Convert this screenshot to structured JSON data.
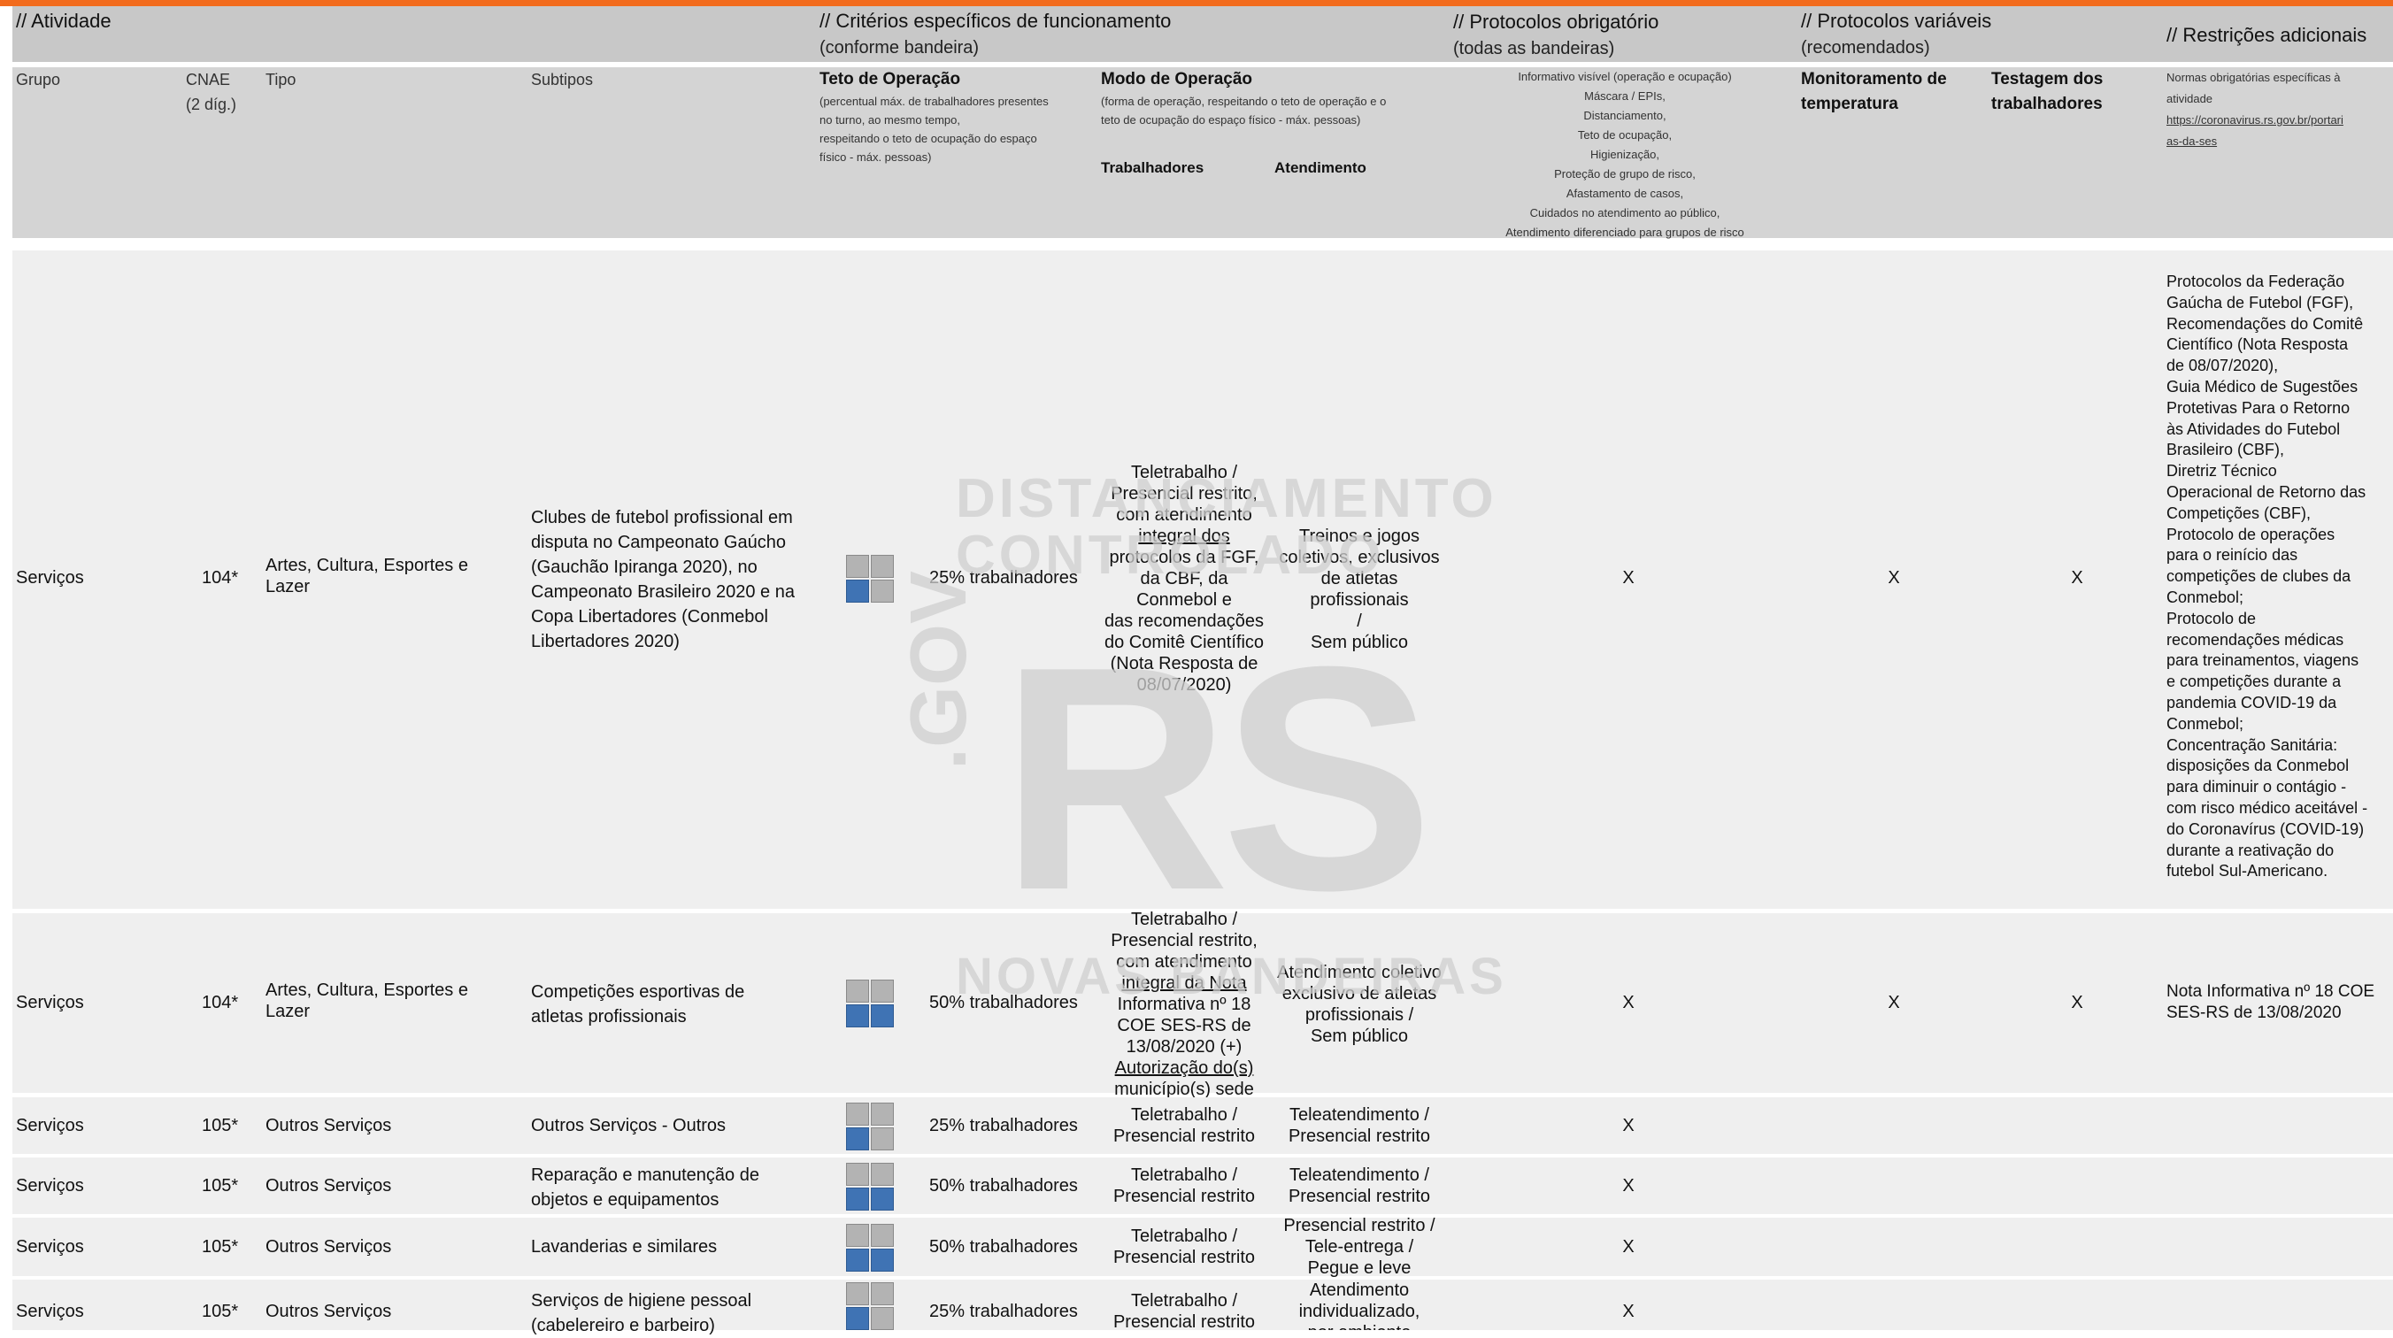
{
  "sections": {
    "atividade": "// Atividade",
    "criterios": "// Critérios específicos de funcionamento",
    "criterios_sub": "(conforme bandeira)",
    "protocolos_obrig": "// Protocolos obrigatório",
    "protocolos_obrig_sub": "(todas as bandeiras)",
    "protocolos_var": "// Protocolos variáveis",
    "protocolos_var_sub": "(recomendados)",
    "restricoes": "// Restrições adicionais"
  },
  "columns": {
    "grupo": "Grupo",
    "cnae_1": "CNAE",
    "cnae_2": "(2 díg.)",
    "tipo": "Tipo",
    "subtipos": "Subtipos",
    "teto": "Teto de Operação",
    "teto_desc": [
      "(percentual máx. de trabalhadores presentes",
      "no turno, ao mesmo tempo,",
      "respeitando o teto de ocupação do espaço",
      "físico - máx. pessoas)"
    ],
    "modo": "Modo de Operação",
    "modo_desc": [
      "(forma de operação, respeitando o teto de operação e o",
      "teto de ocupação do espaço físico - máx. pessoas)"
    ],
    "trabalhadores": "Trabalhadores",
    "atendimento": "Atendimento",
    "protocolos_list": [
      "Informativo visível (operação e ocupação)",
      "Máscara / EPIs,",
      "Distanciamento,",
      "Teto de ocupação,",
      "Higienização,",
      "Proteção de grupo de risco,",
      "Afastamento de casos,",
      "Cuidados no atendimento ao público,",
      "Atendimento diferenciado para grupos de risco"
    ],
    "monitoramento_1": "Monitoramento de",
    "monitoramento_2": "temperatura",
    "testagem_1": "Testagem dos",
    "testagem_2": "trabalhadores",
    "normas_1": "Normas obrigatórias específicas à",
    "normas_2": "atividade",
    "normas_link_1": "https://coronavirus.rs.gov.br/portari",
    "normas_link_2": "as-da-ses"
  },
  "watermark": {
    "line1": "DISTANCIAMENTO",
    "line2": "CONTROLADO",
    "line3": "NOVAS BANDEIRAS",
    "gov": ".GOV",
    "rs": "RS"
  },
  "rows": [
    {
      "grupo": "Serviços",
      "cnae": "104*",
      "tipo": [
        "Artes, Cultura, Esportes e",
        "Lazer"
      ],
      "subtipo": [
        "Clubes de futebol profissional em",
        "disputa no Campeonato Gaúcho",
        "(Gauchão Ipiranga 2020), no",
        "Campeonato Brasileiro 2020 e na",
        "Copa Libertadores (Conmebol",
        "Libertadores 2020)"
      ],
      "teto": "25% trabalhadores",
      "trabalhadores": [
        "Teletrabalho /",
        "Presencial restrito,",
        "com atendimento",
        "integral dos",
        "protocolos da FGF,",
        "da CBF, da",
        "Conmebol e",
        "das recomendações",
        "do Comitê Científico",
        "(Nota Resposta de",
        "08/07/2020)"
      ],
      "atendimento": [
        "Treinos e jogos",
        "coletivos, exclusivos",
        "de atletas profissionais",
        "/",
        "Sem público"
      ],
      "obrig": "X",
      "monit": "X",
      "testagem": "X",
      "restricoes": [
        "Protocolos da Federação",
        "Gaúcha de Futebol (FGF),",
        "Recomendações do Comitê",
        "Científico (Nota Resposta",
        "de 08/07/2020),",
        "Guia Médico de Sugestões",
        "Protetivas Para o Retorno",
        "às Atividades do Futebol",
        "Brasileiro (CBF),",
        "Diretriz Técnico",
        "Operacional de Retorno das",
        "Competições (CBF),",
        "Protocolo de operações",
        "para o reinício das",
        "competições de clubes da",
        "Conmebol;",
        "Protocolo de",
        "recomendações médicas",
        "para treinamentos, viagens",
        "e competições durante a",
        "pandemia COVID-19 da",
        "Conmebol;",
        "Concentração Sanitária:",
        "disposições da Conmebol",
        "para diminuir o contágio -",
        "com risco médico aceitável -",
        "do Coronavírus (COVID-19)",
        "durante a reativação do",
        "futebol Sul-Americano."
      ]
    },
    {
      "grupo": "Serviços",
      "cnae": "104*",
      "tipo": [
        "Artes, Cultura, Esportes e",
        "Lazer"
      ],
      "subtipo": [
        "Competições esportivas de",
        "atletas profissionais"
      ],
      "teto": "50% trabalhadores",
      "trabalhadores": [
        "Teletrabalho /",
        "Presencial restrito,",
        "com atendimento",
        "integral da Nota",
        "Informativa nº 18",
        "COE SES-RS de",
        "13/08/2020 (+)",
        "Autorização do(s)",
        "município(s) sede"
      ],
      "atendimento": [
        "Atendimento coletivo",
        "exclusivo de atletas",
        "profissionais /",
        "Sem público"
      ],
      "obrig": "X",
      "monit": "X",
      "testagem": "X",
      "restricoes": [
        "Nota Informativa nº 18 COE",
        "SES-RS de 13/08/2020"
      ]
    },
    {
      "grupo": "Serviços",
      "cnae": "105*",
      "tipo": [
        "Outros Serviços"
      ],
      "subtipo": [
        "Outros Serviços - Outros"
      ],
      "teto": "25% trabalhadores",
      "trabalhadores": [
        "Teletrabalho /",
        "Presencial restrito"
      ],
      "atendimento": [
        "Teleatendimento /",
        "Presencial restrito"
      ],
      "obrig": "X"
    },
    {
      "grupo": "Serviços",
      "cnae": "105*",
      "tipo": [
        "Outros Serviços"
      ],
      "subtipo": [
        "Reparação e manutenção de",
        "objetos e equipamentos"
      ],
      "teto": "50% trabalhadores",
      "trabalhadores": [
        "Teletrabalho /",
        "Presencial restrito"
      ],
      "atendimento": [
        "Teleatendimento /",
        "Presencial restrito"
      ],
      "obrig": "X"
    },
    {
      "grupo": "Serviços",
      "cnae": "105*",
      "tipo": [
        "Outros Serviços"
      ],
      "subtipo": [
        "Lavanderias e similares"
      ],
      "teto": "50% trabalhadores",
      "trabalhadores": [
        "Teletrabalho /",
        "Presencial restrito"
      ],
      "atendimento": [
        "Presencial restrito /",
        "Tele-entrega /",
        "Pegue e leve"
      ],
      "obrig": "X"
    },
    {
      "grupo": "Serviços",
      "cnae": "105*",
      "tipo": [
        "Outros Serviços"
      ],
      "subtipo": [
        "Serviços de higiene pessoal",
        "(cabelereiro e barbeiro)"
      ],
      "teto": "25% trabalhadores",
      "trabalhadores": [
        "Teletrabalho /",
        "Presencial restrito"
      ],
      "atendimento": [
        "Atendimento",
        "individualizado,",
        "por ambiente"
      ],
      "obrig": "X"
    }
  ]
}
